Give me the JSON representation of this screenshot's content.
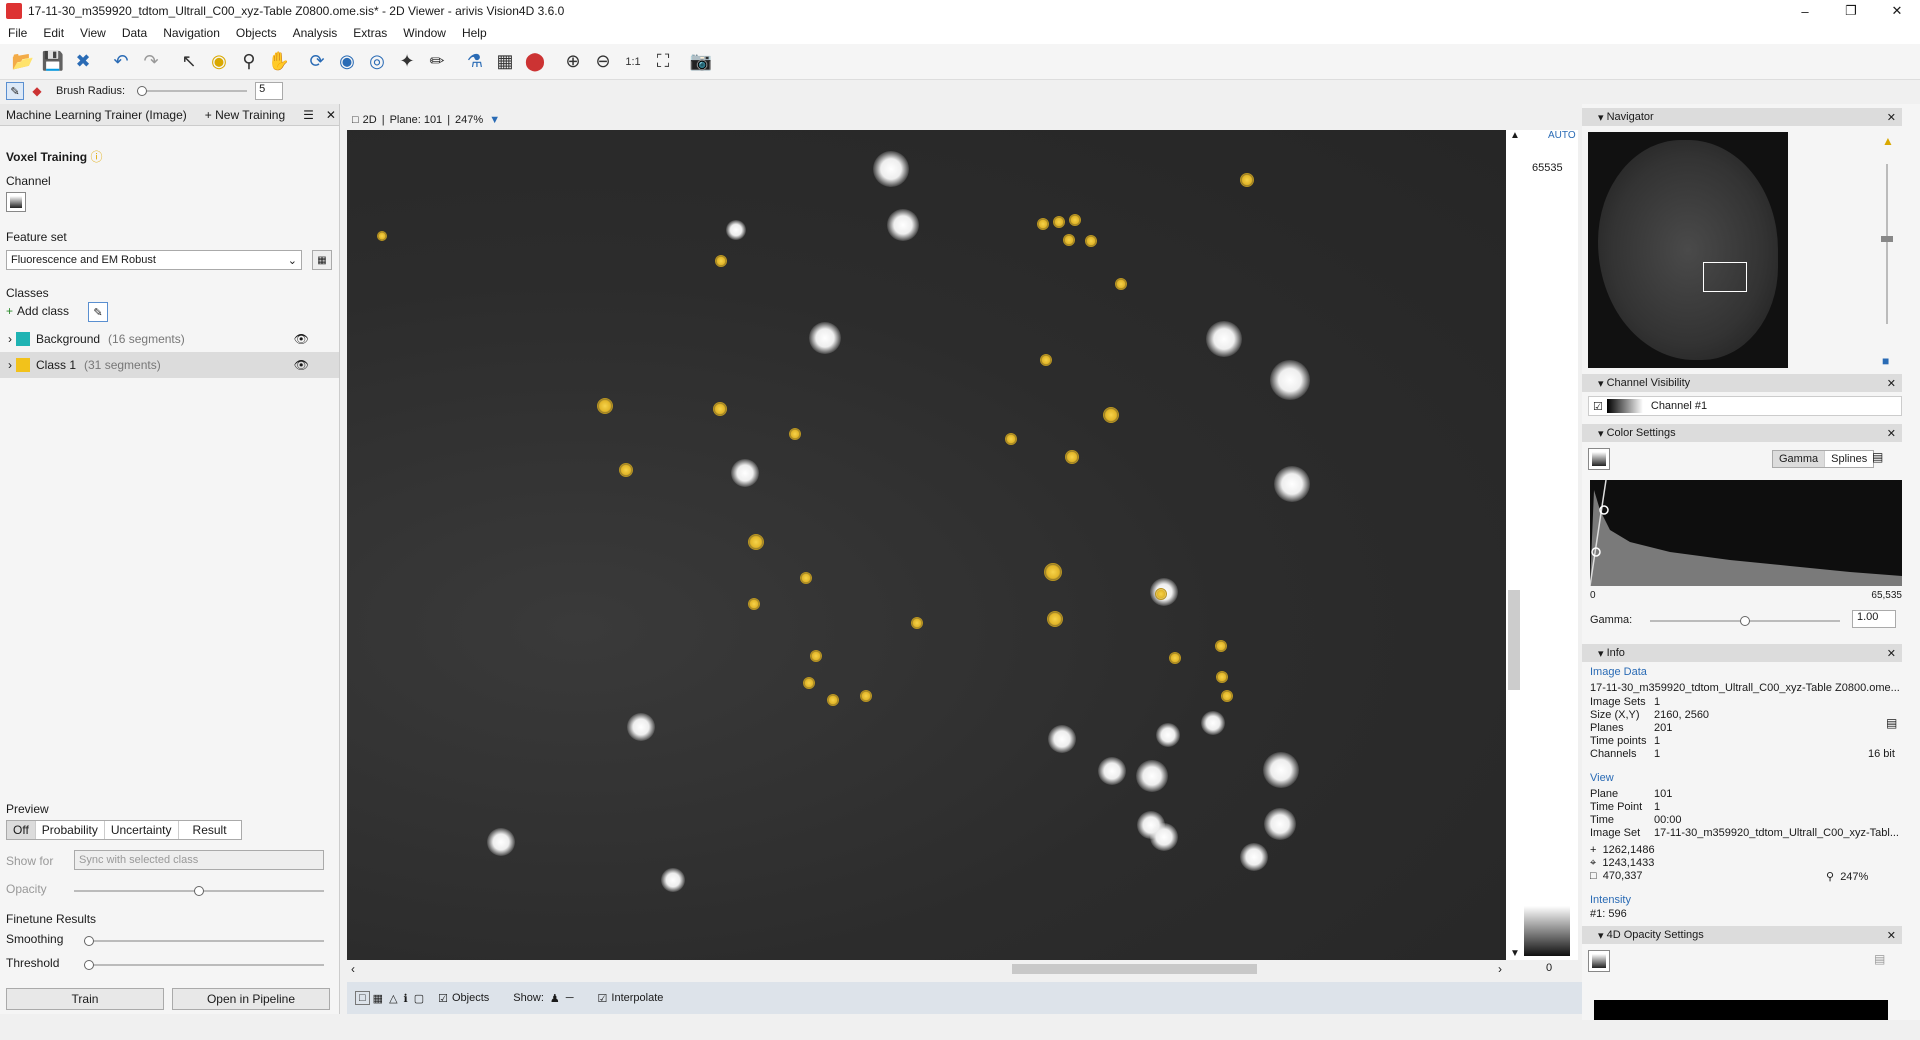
{
  "window": {
    "title": "17-11-30_m359920_tdtom_Ultrall_C00_xyz-Table Z0800.ome.sis* - 2D Viewer - arivis Vision4D 3.6.0",
    "minimize": "–",
    "maximize": "❐",
    "close": "✕"
  },
  "menu": [
    "File",
    "Edit",
    "View",
    "Data",
    "Navigation",
    "Objects",
    "Analysis",
    "Extras",
    "Window",
    "Help"
  ],
  "brush": {
    "label": "Brush Radius:",
    "value": "5"
  },
  "panel": {
    "tab_title": "Machine Learning Trainer (Image)",
    "new_training": "+ New Training",
    "voxel_training": "Voxel Training",
    "channel_label": "Channel",
    "feature_set_label": "Feature set",
    "feature_set_value": "Fluorescence and EM Robust",
    "classes_label": "Classes",
    "add_class": "Add class",
    "classes": [
      {
        "name": "Background",
        "count": "(16 segments)",
        "color": "#1fb3b3"
      },
      {
        "name": "Class 1",
        "count": "(31 segments)",
        "color": "#f2c21b"
      }
    ],
    "preview_label": "Preview",
    "preview_tabs": [
      "Off",
      "Probability",
      "Uncertainty",
      "Result"
    ],
    "show_for_label": "Show for",
    "show_for_value": "Sync with selected class",
    "opacity_label": "Opacity",
    "finetune_label": "Finetune Results",
    "smoothing_label": "Smoothing",
    "threshold_label": "Threshold",
    "train": "Train",
    "open_pipeline": "Open in Pipeline"
  },
  "viewer": {
    "mode": "2D",
    "plane": "Plane: 101",
    "zoom": "247%",
    "auto": "AUTO",
    "max": "65535",
    "min": "0"
  },
  "bottom": {
    "objects": "Objects",
    "show": "Show:",
    "interpolate": "Interpolate"
  },
  "navigator": {
    "title": "Navigator"
  },
  "channel_visibility": {
    "title": "Channel Visibility",
    "channel": "Channel #1"
  },
  "color_settings": {
    "title": "Color Settings",
    "gamma_btn": "Gamma",
    "splines_btn": "Splines",
    "min": "0",
    "max": "65,535",
    "gamma_label": "Gamma:",
    "gamma_value": "1.00"
  },
  "info": {
    "title": "Info",
    "image_data": "Image Data",
    "filename": "17-11-30_m359920_tdtom_Ultrall_C00_xyz-Table Z0800.ome...",
    "rows": [
      {
        "k": "Image Sets",
        "v": "1"
      },
      {
        "k": "Size (X,Y)",
        "v": "2160, 2560"
      },
      {
        "k": "Planes",
        "v": "201"
      },
      {
        "k": "Time points",
        "v": "1"
      },
      {
        "k": "Channels",
        "v": "1"
      }
    ],
    "bit": "16 bit",
    "view": "View",
    "view_rows": [
      {
        "k": "Plane",
        "v": "101"
      },
      {
        "k": "Time Point",
        "v": "1"
      },
      {
        "k": "Time",
        "v": "00:00"
      },
      {
        "k": "Image Set",
        "v": "17-11-30_m359920_tdtom_Ultrall_C00_xyz-Tabl..."
      }
    ],
    "coord1": "1262,1486",
    "coord2": "1243,1433",
    "coord3": "470,337",
    "zoom": "247%",
    "intensity": "Intensity",
    "intensity_value": "#1: 596"
  },
  "opacity_settings": {
    "title": "4D Opacity Settings"
  }
}
